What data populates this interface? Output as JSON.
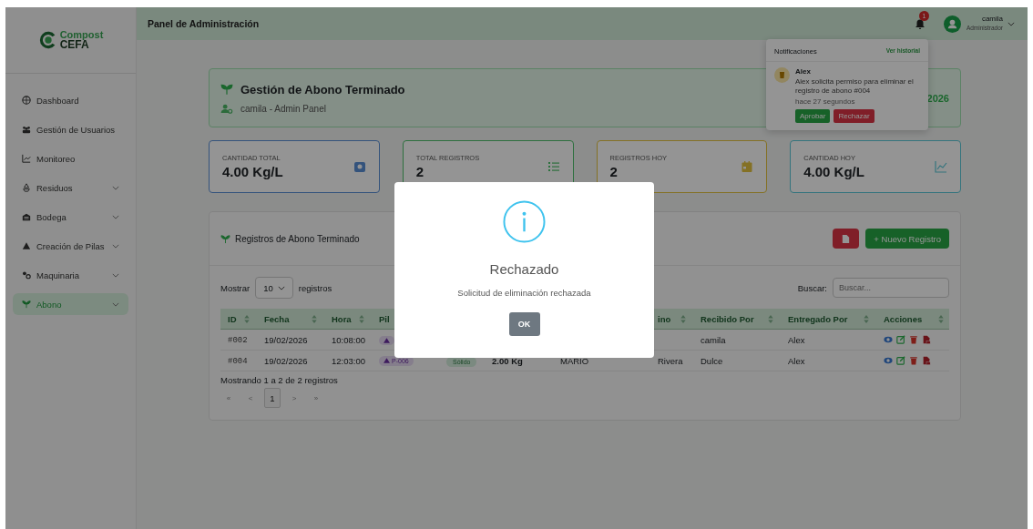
{
  "sidebar": {
    "logo": {
      "line1": "Compost",
      "line2": "CEFA"
    },
    "items": [
      {
        "label": "Dashboard",
        "expandable": false,
        "selected": false
      },
      {
        "label": "Gestión de Usuarios",
        "expandable": false,
        "selected": false
      },
      {
        "label": "Monitoreo",
        "expandable": false,
        "selected": false
      },
      {
        "label": "Residuos",
        "expandable": true,
        "selected": false
      },
      {
        "label": "Bodega",
        "expandable": true,
        "selected": false
      },
      {
        "label": "Creación de Pilas",
        "expandable": true,
        "selected": false
      },
      {
        "label": "Maquinaria",
        "expandable": true,
        "selected": false
      },
      {
        "label": "Abono",
        "expandable": true,
        "selected": true
      }
    ]
  },
  "topbar": {
    "title": "Panel de Administración",
    "notification_count": "1",
    "user": {
      "name": "camila",
      "role": "Administrador"
    }
  },
  "header": {
    "title": "Gestión de Abono Terminado",
    "subtitle": "camila - Admin Panel",
    "date": "2026"
  },
  "stats": [
    {
      "label": "CANTIDAD TOTAL",
      "value": "4.00 Kg/L"
    },
    {
      "label": "TOTAL REGISTROS",
      "value": "2"
    },
    {
      "label": "REGISTROS HOY",
      "value": "2"
    },
    {
      "label": "CANTIDAD HOY",
      "value": "4.00 Kg/L"
    }
  ],
  "records": {
    "title": "Registros de Abono Terminado",
    "new_button": "+ Nuevo Registro",
    "show_label": "Mostrar",
    "page_size": "10",
    "show_suffix": "registros",
    "search_label": "Buscar:",
    "search_placeholder": "Buscar...",
    "columns": [
      {
        "label": "ID",
        "sortable": true
      },
      {
        "label": "Fecha",
        "sortable": true
      },
      {
        "label": "Hora",
        "sortable": true
      },
      {
        "label": "Pil",
        "sortable": false
      },
      {},
      {},
      {},
      {
        "label": "ino",
        "sortable": true
      },
      {
        "label": "Recibido Por",
        "sortable": true
      },
      {
        "label": "Entregado Por",
        "sortable": true
      },
      {
        "label": "Acciones",
        "sortable": true
      }
    ],
    "rows": [
      {
        "cells": [
          {
            "kind": "id",
            "text": "#002"
          },
          {
            "kind": "text",
            "text": "19/02/2026"
          },
          {
            "kind": "text",
            "text": "10:08:00"
          },
          {
            "kind": "pila"
          },
          {
            "kind": "empty"
          },
          {
            "kind": "empty"
          },
          {
            "kind": "empty"
          },
          {
            "kind": "empty"
          },
          {
            "kind": "text",
            "text": "camila"
          },
          {
            "kind": "text",
            "text": "Alex"
          },
          {
            "kind": "actions"
          }
        ]
      },
      {
        "cells": [
          {
            "kind": "id",
            "text": "#004"
          },
          {
            "kind": "text",
            "text": "19/02/2026"
          },
          {
            "kind": "text",
            "text": "12:03:00"
          },
          {
            "kind": "pila",
            "text": "P-006"
          },
          {
            "kind": "tipo",
            "text": "Sólido"
          },
          {
            "kind": "bold",
            "text": "2.00 Kg"
          },
          {
            "kind": "text",
            "text": "MARIO"
          },
          {
            "kind": "text",
            "text": "Rivera"
          },
          {
            "kind": "text",
            "text": "Dulce"
          },
          {
            "kind": "text",
            "text": "Alex"
          },
          {
            "kind": "actions"
          }
        ]
      }
    ],
    "info": "Mostrando 1 a 2 de 2 registros",
    "pagination": [
      {
        "label": "«",
        "selected": false
      },
      {
        "label": "<",
        "selected": false
      },
      {
        "label": "1",
        "selected": true
      },
      {
        "label": ">",
        "selected": false
      },
      {
        "label": "»",
        "selected": false
      }
    ]
  },
  "notifications": {
    "title": "Notificaciones",
    "history_link": "Ver historial",
    "items": [
      {
        "name": "Alex",
        "message": "Alex solicita permiso para eliminar el registro de abono #004",
        "time": "hace 27 segundos",
        "approve": "Aprobar",
        "reject": "Rechazar"
      }
    ]
  },
  "modal": {
    "title": "Rechazado",
    "message": "Solicitud de eliminación rechazada",
    "button": "OK"
  }
}
